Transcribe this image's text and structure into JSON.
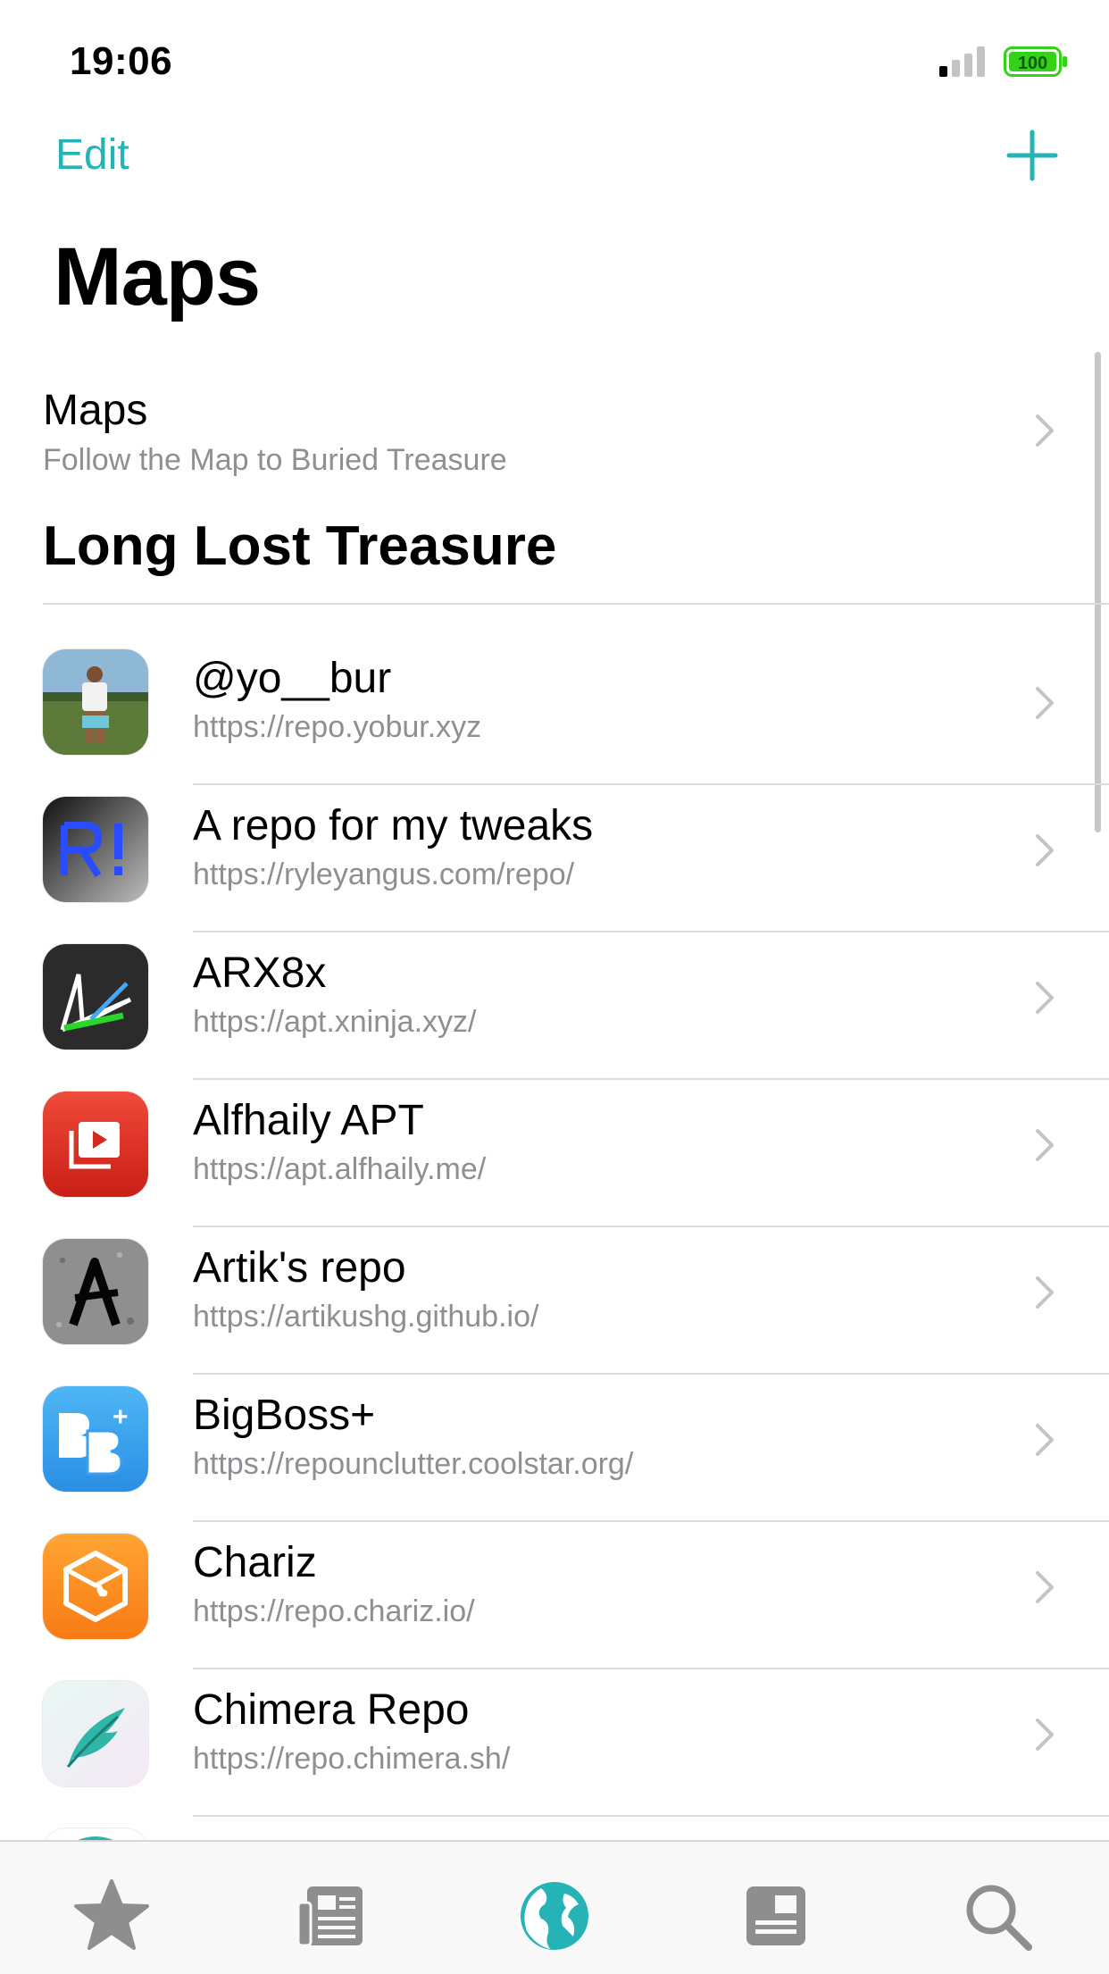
{
  "status_bar": {
    "time": "19:06",
    "battery": "100"
  },
  "nav": {
    "edit_label": "Edit",
    "add_icon": "plus-icon",
    "title": "Maps"
  },
  "featured": {
    "title": "Maps",
    "subtitle": "Follow the Map to Buried Treasure"
  },
  "section": {
    "title": "Long Lost Treasure"
  },
  "repos": [
    {
      "name": "@yo__bur",
      "url": "https://repo.yobur.xyz",
      "icon": "photo-avatar-icon"
    },
    {
      "name": "A repo for my tweaks",
      "url": "https://ryleyangus.com/repo/",
      "icon": "r-exclaim-icon"
    },
    {
      "name": "ARX8x",
      "url": "https://apt.xninja.xyz/",
      "icon": "arrows-icon"
    },
    {
      "name": "Alfhaily APT",
      "url": "https://apt.alfhaily.me/",
      "icon": "play-media-icon"
    },
    {
      "name": "Artik's repo",
      "url": "https://artikushg.github.io/",
      "icon": "letter-a-icon"
    },
    {
      "name": "BigBoss+",
      "url": "https://repounclutter.coolstar.org/",
      "icon": "bigboss-icon"
    },
    {
      "name": "Chariz",
      "url": "https://repo.chariz.io/",
      "icon": "chariz-box-icon"
    },
    {
      "name": "Chimera Repo",
      "url": "https://repo.chimera.sh/",
      "icon": "feather-icon"
    }
  ],
  "tabs": [
    {
      "name": "featured",
      "icon": "star-icon"
    },
    {
      "name": "news",
      "icon": "news-icon"
    },
    {
      "name": "sources",
      "icon": "globe-icon",
      "selected": true
    },
    {
      "name": "packages",
      "icon": "package-icon"
    },
    {
      "name": "search",
      "icon": "search-icon"
    }
  ],
  "colors": {
    "accent": "#25b3b5",
    "secondary_text": "#8e8e93",
    "tab_inactive": "#8e8e8e"
  }
}
